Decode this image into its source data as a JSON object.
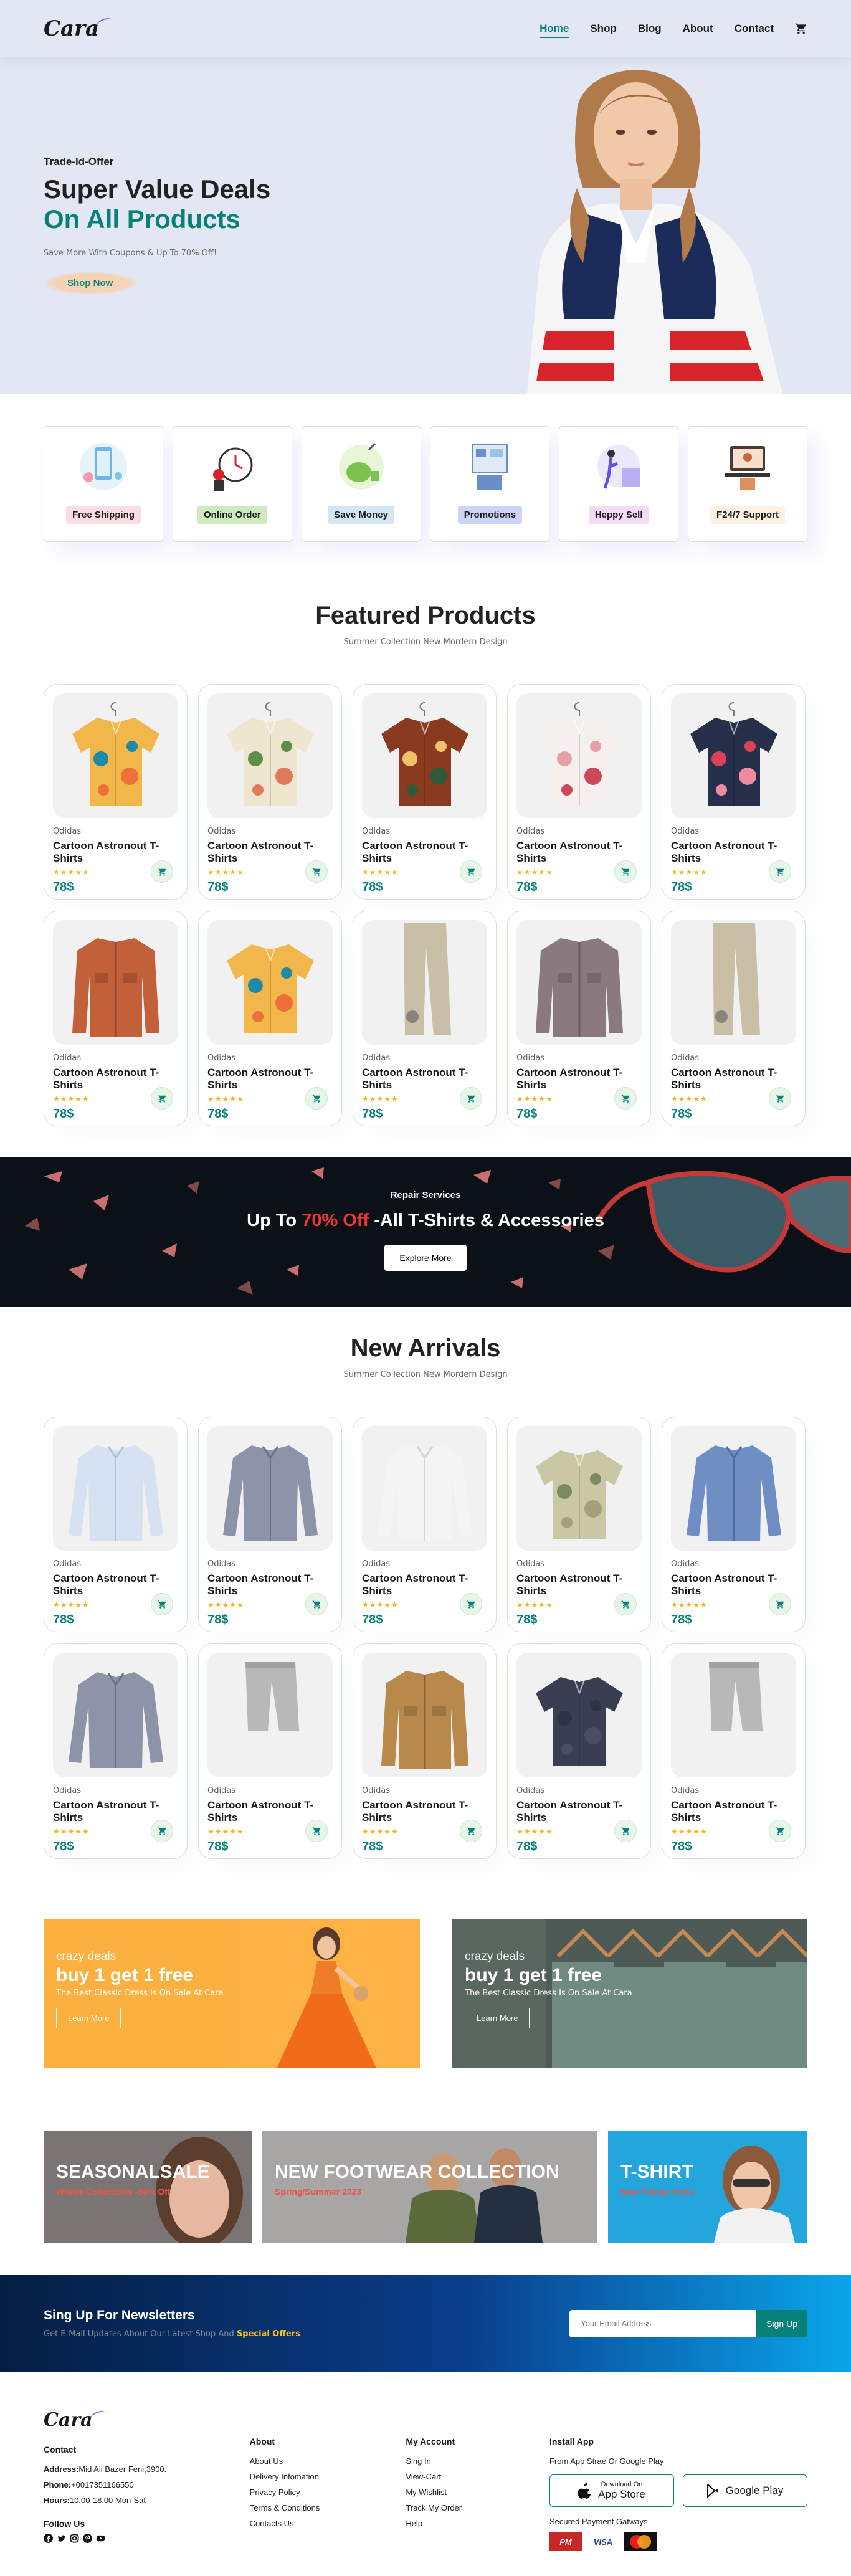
{
  "header": {
    "logo": "Cara",
    "nav": [
      "Home",
      "Shop",
      "Blog",
      "About",
      "Contact"
    ]
  },
  "hero": {
    "kicker": "Trade-Id-Offer",
    "title_line1": "Super Value Deals",
    "title_line2": "On All Products",
    "subtitle": "Save More With Coupons & Up To 70% Off!",
    "cta": "Shop Now"
  },
  "features": [
    {
      "label": "Free Shipping",
      "bg": "#fddde4"
    },
    {
      "label": "Online Order",
      "bg": "#cdebbc"
    },
    {
      "label": "Save Money",
      "bg": "#d1e8f2"
    },
    {
      "label": "Promotions",
      "bg": "#cdd4f8"
    },
    {
      "label": "Heppy Sell",
      "bg": "#f6dbf6"
    },
    {
      "label": "F24/7 Support",
      "bg": "#fff2e5"
    }
  ],
  "featured": {
    "title": "Featured Products",
    "subtitle": "Summer Collection New Mordern Design"
  },
  "new_arrivals": {
    "title": "New Arrivals",
    "subtitle": "Summer Collection New Mordern Design"
  },
  "product_card": {
    "brand": "Odidas",
    "name": "Cartoon Astronout T-Shirts",
    "stars": "★★★★★",
    "price": "78$"
  },
  "banner": {
    "kicker": "Repair Services",
    "title_pre": "Up To ",
    "title_hl": "70% Off",
    "title_post": " -All T-Shirts & Accessories",
    "cta": "Explore More"
  },
  "small_banners": [
    {
      "kicker": "crazy deals",
      "title": "buy 1 get 1 free",
      "sub": "The Best Classic Dress Is On Sale At Cara",
      "cta": "Learn More"
    },
    {
      "kicker": "crazy deals",
      "title": "buy 1 get 1 free",
      "sub": "The Best Classic Dress Is On Sale At Cara",
      "cta": "Learn More"
    }
  ],
  "tri_banners": [
    {
      "title": "SEASONALSALE",
      "sub": "Winter Collections -50% Off"
    },
    {
      "title": "NEW FOOTWEAR COLLECTION",
      "sub": "Spring/Summer 2023"
    },
    {
      "title": "T-SHIRT",
      "sub": "New Trendy Prins"
    }
  ],
  "newsletter": {
    "title": "Sing Up For Newsletters",
    "sub_pre": "Get E-Mail Updates About Our Latest Shop And ",
    "sub_hl": "Special Offers",
    "placeholder": "Your Email Address",
    "button": "Sign Up"
  },
  "footer": {
    "logo": "Cara",
    "contact_title": "Contact",
    "address_label": "Address:",
    "address": "Mid Ali Bazer Feni,3900.",
    "phone_label": "Phone:",
    "phone": "+0017351166550",
    "hours_label": "Hours:",
    "hours": "10.00-18.00 Mon-Sat",
    "follow": "Follow Us",
    "about_title": "About",
    "about_links": [
      "About Us",
      "Delivery Infomation",
      "Privacy Policy",
      "Terms & Conditions",
      "Contacts Us"
    ],
    "account_title": "My Account",
    "account_links": [
      "Sing In",
      "View-Cart",
      "My Wishlist",
      "Track My Order",
      "Help"
    ],
    "install_title": "Install App",
    "install_sub": "From App Strae Or Google Play",
    "app_store_small": "Download On",
    "app_store_big": "App Store",
    "google_play": "Google Play",
    "secured": "Secured Payment Gatways",
    "pay": [
      "PM",
      "VISA",
      "Master"
    ]
  },
  "colors": {
    "accent": "#088178",
    "hero_bg": "#e3e6f3",
    "banner_bg": "#0c1118",
    "banner_highlight": "#ef3636",
    "star": "#f3b519"
  }
}
